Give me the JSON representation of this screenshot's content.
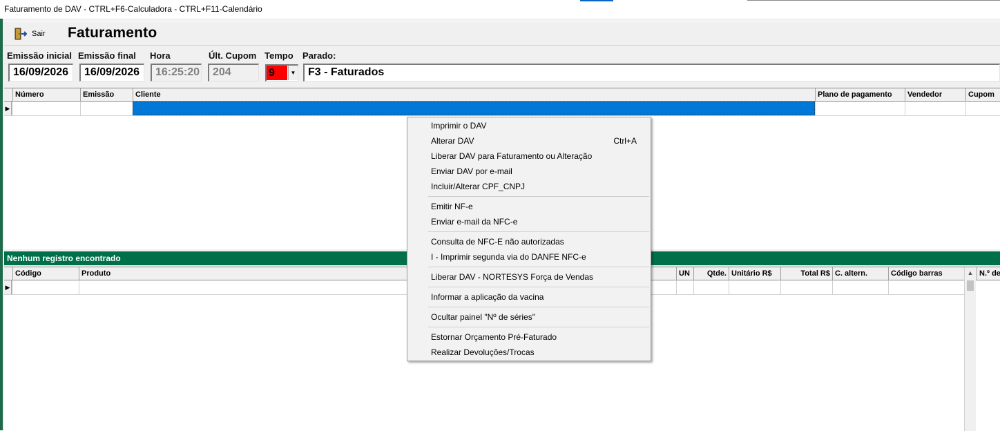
{
  "window_title": "Faturamento de DAV -  CTRL+F6-Calculadora - CTRL+F11-Calendário",
  "toolbar": {
    "sair_label": "Sair",
    "page_title": "Faturamento"
  },
  "filters": {
    "emissao_inicial_label": "Emissão inicial",
    "emissao_inicial_value": "16/09/2026",
    "emissao_final_label": "Emissão final",
    "emissao_final_value": "16/09/2026",
    "hora_label": "Hora",
    "hora_value": "16:25:20",
    "ult_cupom_label": "Últ. Cupom",
    "ult_cupom_value": "204",
    "tempo_label": "Tempo",
    "tempo_value": "9",
    "parado_label": "Parado:",
    "parado_value": "F3 - Faturados"
  },
  "top_grid": {
    "columns": [
      "Número",
      "Emissão",
      "Cliente",
      "Plano de pagamento",
      "Vendedor",
      "Cupom"
    ]
  },
  "status": {
    "message": "Nenhum registro encontrado"
  },
  "bottom_grid": {
    "columns": [
      "Código",
      "Produto",
      "UN",
      "Qtde.",
      "Unitário R$",
      "Total R$",
      "C. altern.",
      "Código barras",
      "N.º de"
    ]
  },
  "context_menu": {
    "groups": [
      [
        {
          "label": "Imprimir o DAV",
          "shortcut": ""
        },
        {
          "label": "Alterar DAV",
          "shortcut": "Ctrl+A"
        },
        {
          "label": "Liberar DAV para Faturamento ou Alteração",
          "shortcut": ""
        },
        {
          "label": "Enviar DAV por e-mail",
          "shortcut": ""
        },
        {
          "label": "Incluir/Alterar CPF_CNPJ",
          "shortcut": ""
        }
      ],
      [
        {
          "label": "Emitir NF-e",
          "shortcut": ""
        },
        {
          "label": "Enviar e-mail da NFC-e",
          "shortcut": ""
        }
      ],
      [
        {
          "label": "Consulta de NFC-E não autorizadas",
          "shortcut": ""
        },
        {
          "label": "I - Imprimir segunda via do DANFE NFC-e",
          "shortcut": ""
        }
      ],
      [
        {
          "label": "Liberar DAV - NORTESYS Força de Vendas",
          "shortcut": ""
        }
      ],
      [
        {
          "label": "Informar a aplicação da vacina",
          "shortcut": ""
        }
      ],
      [
        {
          "label": "Ocultar painel \"Nº de séries\"",
          "shortcut": ""
        }
      ],
      [
        {
          "label": "Estornar Orçamento Pré-Faturado",
          "shortcut": ""
        },
        {
          "label": "Realizar Devoluções/Trocas",
          "shortcut": ""
        }
      ]
    ]
  },
  "colors": {
    "status_bar": "#00704a",
    "selection": "#0078d7",
    "tempo_bg": "#ff0000"
  }
}
